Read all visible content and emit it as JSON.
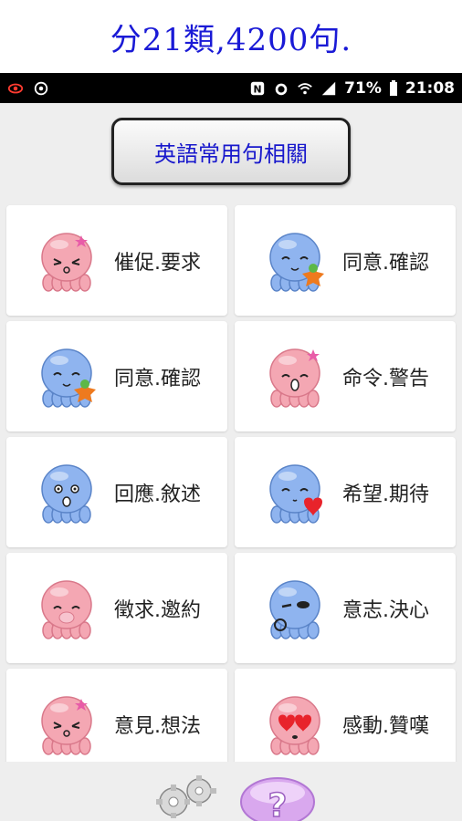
{
  "banner": {
    "text": "分21類,4200句."
  },
  "status_bar": {
    "left_icons": [
      "eye-icon",
      "sync-icon"
    ],
    "right_icons": [
      "nfc-icon",
      "alarm-icon",
      "wifi-icon",
      "signal-icon"
    ],
    "battery": "71%",
    "time": "21:08"
  },
  "header_button": {
    "label": "英語常用句相關"
  },
  "categories": [
    {
      "label": "催促.要求",
      "icon": "octopus-pink-sleepy-icon",
      "color": "#f4a7b3"
    },
    {
      "label": "同意.確認",
      "icon": "octopus-blue-ok-icon",
      "color": "#8fb4ef"
    },
    {
      "label": "同意.確認",
      "icon": "octopus-blue-ok-icon",
      "color": "#8fb4ef"
    },
    {
      "label": "命令.警告",
      "icon": "octopus-pink-shout-icon",
      "color": "#f4a7b3"
    },
    {
      "label": "回應.敘述",
      "icon": "octopus-blue-surprised-icon",
      "color": "#8fb4ef"
    },
    {
      "label": "希望.期待",
      "icon": "octopus-blue-heart-icon",
      "color": "#8fb4ef"
    },
    {
      "label": "徵求.邀約",
      "icon": "octopus-pink-happy-icon",
      "color": "#f4a7b3"
    },
    {
      "label": "意志.決心",
      "icon": "octopus-blue-wink-icon",
      "color": "#8fb4ef"
    },
    {
      "label": "意見.想法",
      "icon": "octopus-pink-sleepy-icon",
      "color": "#f4a7b3"
    },
    {
      "label": "感動.贊嘆",
      "icon": "octopus-pink-love-icon",
      "color": "#f4a7b3"
    }
  ],
  "bottom_bar": {
    "settings_icon": "gears-icon",
    "help_icon": "question-mark-icon"
  }
}
